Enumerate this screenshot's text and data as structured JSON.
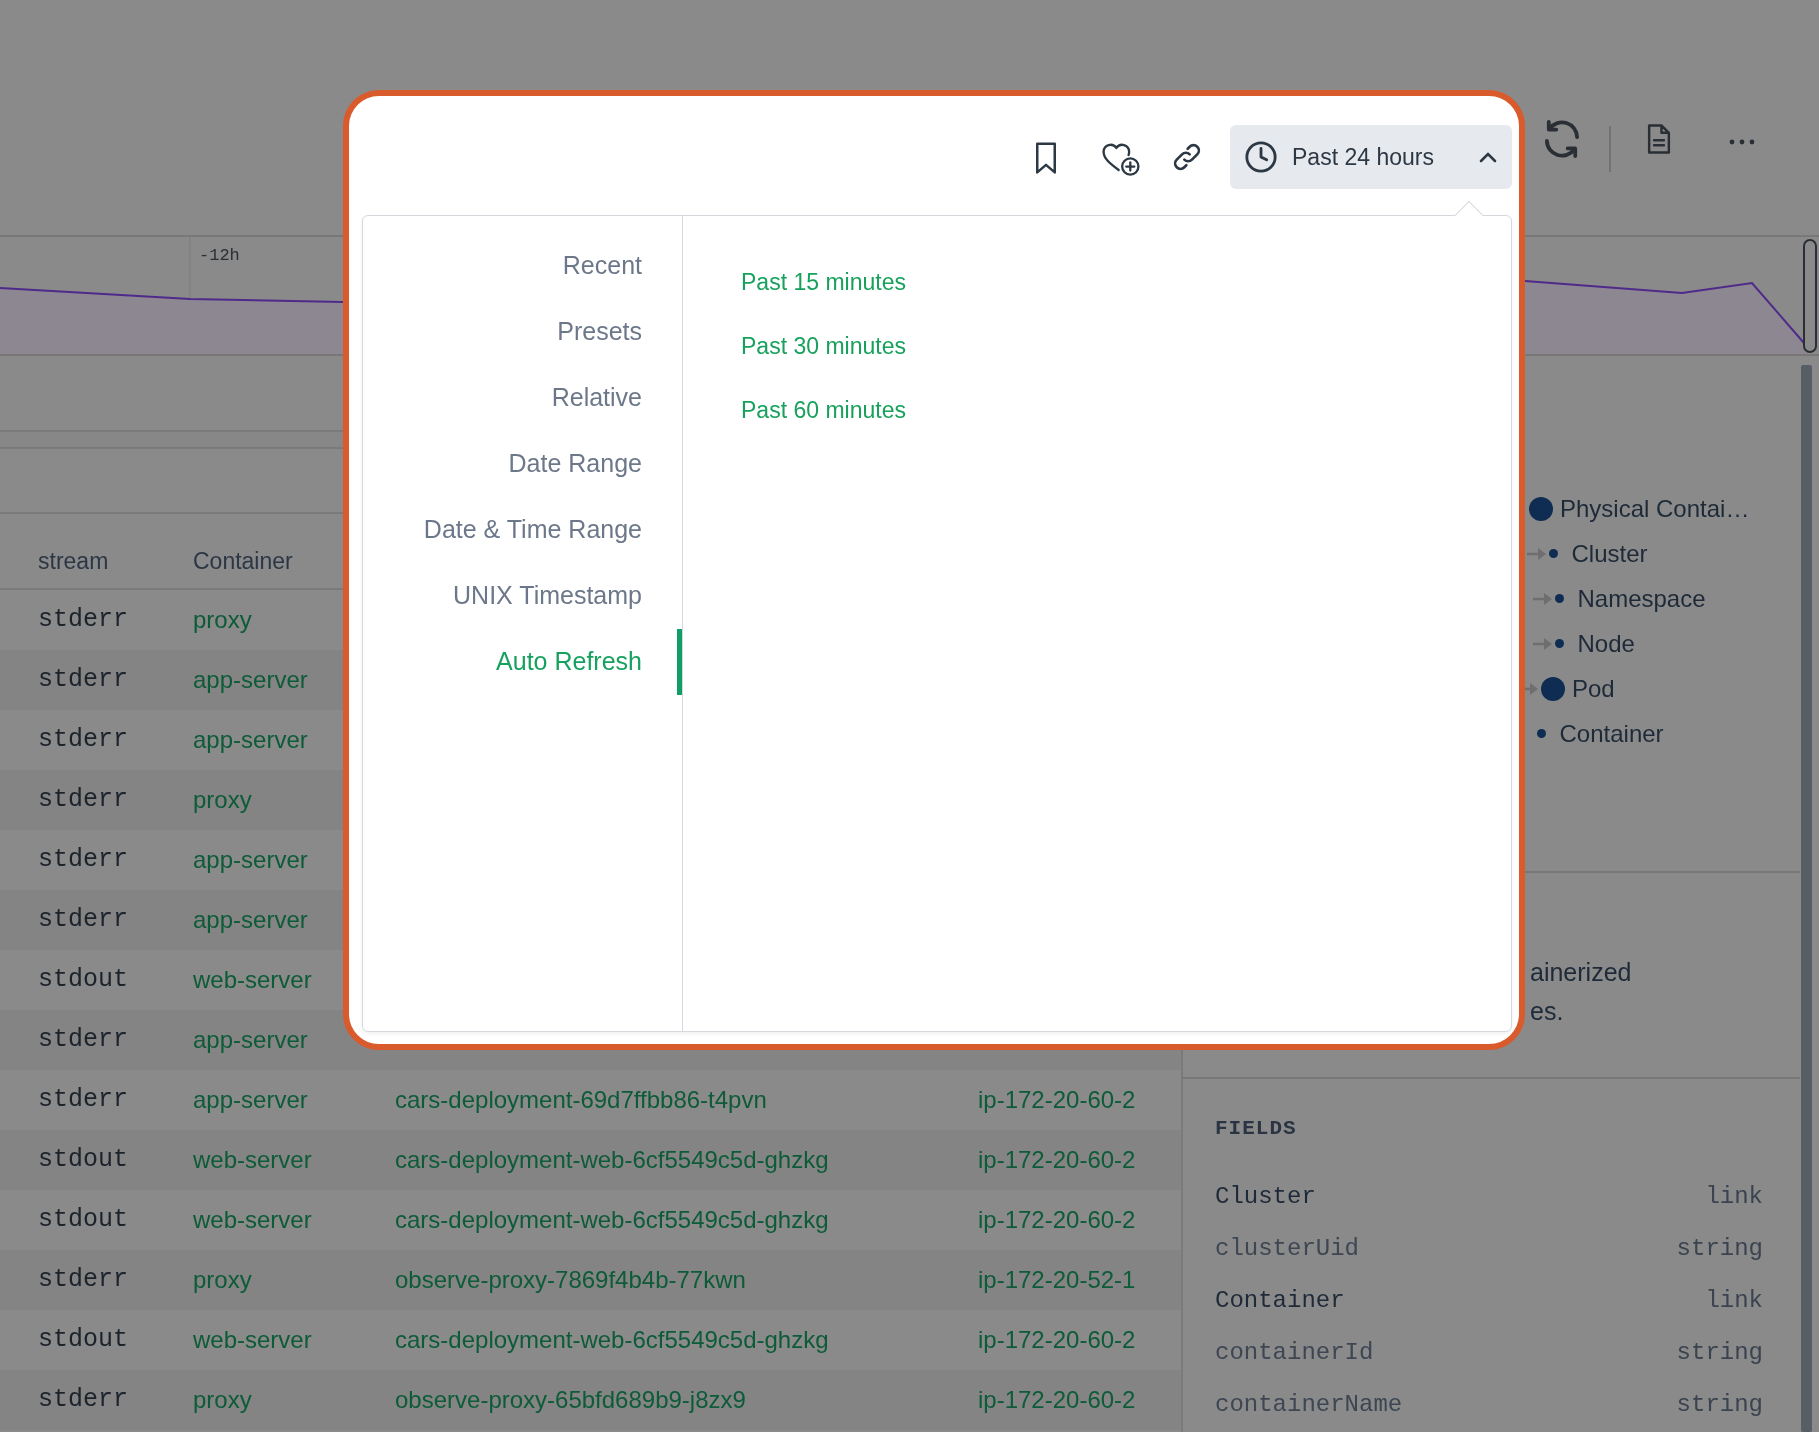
{
  "toolbar": {
    "time_range_button": {
      "label": "Past 24 hours",
      "expanded": true
    }
  },
  "time_menu": {
    "categories": [
      {
        "label": "Recent",
        "selected": false
      },
      {
        "label": "Presets",
        "selected": false
      },
      {
        "label": "Relative",
        "selected": false
      },
      {
        "label": "Date Range",
        "selected": false
      },
      {
        "label": "Date & Time Range",
        "selected": false
      },
      {
        "label": "UNIX Timestamp",
        "selected": false
      },
      {
        "label": "Auto Refresh",
        "selected": true
      }
    ],
    "options": [
      "Past 15 minutes",
      "Past 30 minutes",
      "Past 60 minutes"
    ]
  },
  "chart": {
    "tick_label": "-12h"
  },
  "table": {
    "columns": [
      "stream",
      "Container"
    ],
    "rows": [
      {
        "stream": "stderr",
        "container": "proxy"
      },
      {
        "stream": "stderr",
        "container": "app-server"
      },
      {
        "stream": "stderr",
        "container": "app-server"
      },
      {
        "stream": "stderr",
        "container": "proxy"
      },
      {
        "stream": "stderr",
        "container": "app-server"
      },
      {
        "stream": "stderr",
        "container": "app-server"
      },
      {
        "stream": "stdout",
        "container": "web-server"
      },
      {
        "stream": "stderr",
        "container": "app-server"
      },
      {
        "stream": "stderr",
        "container": "app-server",
        "pod": "cars-deployment-69d7ffbb86-t4pvn",
        "node": "ip-172-20-60-2"
      },
      {
        "stream": "stdout",
        "container": "web-server",
        "pod": "cars-deployment-web-6cf5549c5d-ghzkg",
        "node": "ip-172-20-60-2"
      },
      {
        "stream": "stdout",
        "container": "web-server",
        "pod": "cars-deployment-web-6cf5549c5d-ghzkg",
        "node": "ip-172-20-60-2"
      },
      {
        "stream": "stderr",
        "container": "proxy",
        "pod": "observe-proxy-7869f4b4b-77kwn",
        "node": "ip-172-20-52-1"
      },
      {
        "stream": "stdout",
        "container": "web-server",
        "pod": "cars-deployment-web-6cf5549c5d-ghzkg",
        "node": "ip-172-20-60-2"
      },
      {
        "stream": "stderr",
        "container": "proxy",
        "pod": "observe-proxy-65bfd689b9-j8zx9",
        "node": "ip-172-20-60-2"
      }
    ]
  },
  "resource_graph": {
    "nodes": [
      {
        "label": "Physical Contai…",
        "kind": "large"
      },
      {
        "label": "Cluster",
        "kind": "small"
      },
      {
        "label": "Namespace",
        "kind": "small"
      },
      {
        "label": "Node",
        "kind": "small"
      },
      {
        "label": "Pod",
        "kind": "large"
      },
      {
        "label": "Container",
        "kind": "small"
      }
    ]
  },
  "description": {
    "lines": [
      "ainerized",
      "es."
    ]
  },
  "fields": {
    "heading": "FIELDS",
    "rows": [
      {
        "name": "Cluster",
        "type": "link",
        "emphasized": true
      },
      {
        "name": "clusterUid",
        "type": "string",
        "emphasized": false
      },
      {
        "name": "Container",
        "type": "link",
        "emphasized": true
      },
      {
        "name": "containerId",
        "type": "string",
        "emphasized": false
      },
      {
        "name": "containerName",
        "type": "string",
        "emphasized": false
      }
    ]
  }
}
